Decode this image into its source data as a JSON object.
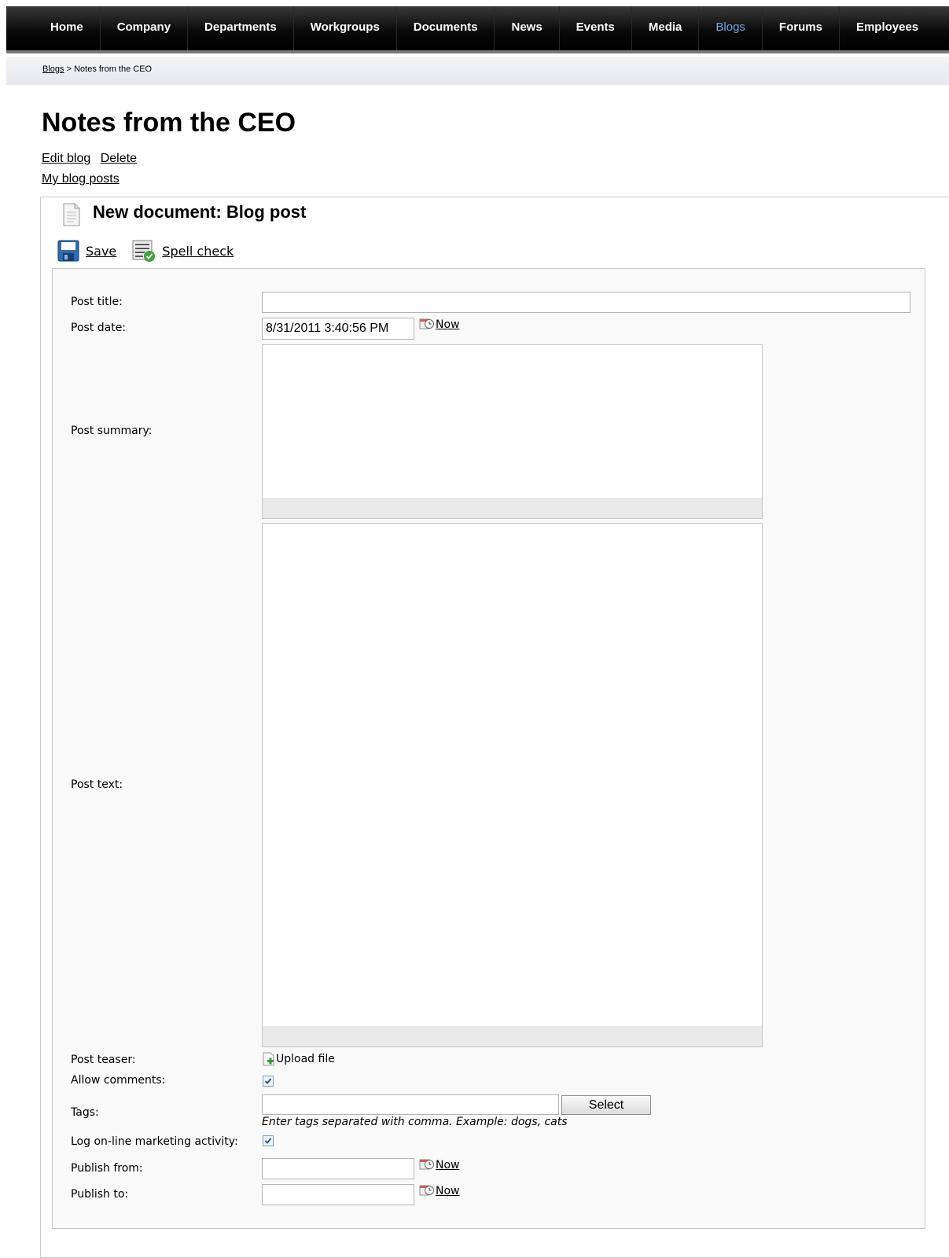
{
  "nav": {
    "items": [
      "Home",
      "Company",
      "Departments",
      "Workgroups",
      "Documents",
      "News",
      "Events",
      "Media",
      "Blogs",
      "Forums",
      "Employees"
    ],
    "active": "Blogs",
    "active_color": "#6aa7e6"
  },
  "breadcrumb": {
    "parent": "Blogs",
    "separator": " > ",
    "current": "Notes from the CEO"
  },
  "page": {
    "title": "Notes from the CEO",
    "edit_blog": "Edit blog",
    "delete": "Delete",
    "my_blog_posts": "My blog posts"
  },
  "document": {
    "title": "New document: Blog post",
    "icon": "document-icon",
    "toolbar": {
      "save": "Save",
      "spell_check": "Spell check"
    }
  },
  "form": {
    "post_title": {
      "label": "Post title:",
      "value": ""
    },
    "post_date": {
      "label": "Post date:",
      "value": "8/31/2011 3:40:56 PM",
      "now": "Now"
    },
    "post_summary": {
      "label": "Post summary:"
    },
    "post_text": {
      "label": "Post text:"
    },
    "post_teaser": {
      "label": "Post teaser:",
      "upload": "Upload file"
    },
    "allow_comments": {
      "label": "Allow comments:",
      "checked": true
    },
    "tags": {
      "label": "Tags:",
      "value": "",
      "select": "Select",
      "hint": "Enter tags separated with comma. Example: dogs, cats"
    },
    "log_activity": {
      "label": "Log on-line marketing activity:",
      "checked": true
    },
    "publish_from": {
      "label": "Publish from:",
      "value": "",
      "now": "Now"
    },
    "publish_to": {
      "label": "Publish to:",
      "value": "",
      "now": "Now"
    }
  }
}
